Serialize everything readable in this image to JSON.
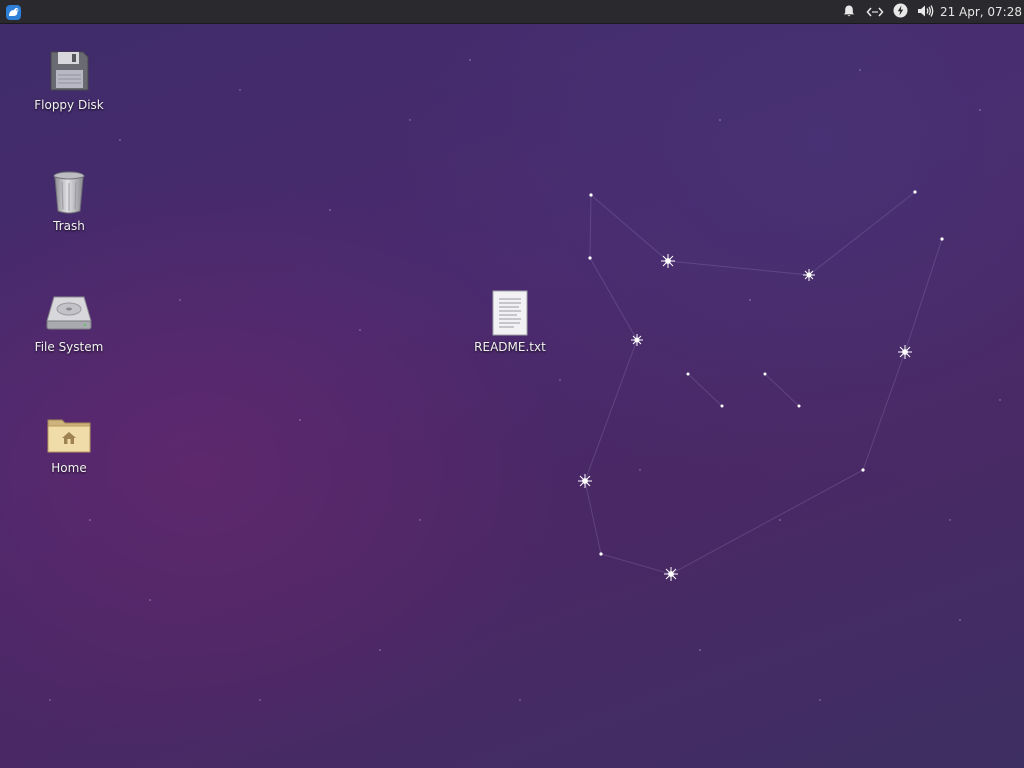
{
  "panel": {
    "menu_icon": "xfce-mouse-logo-icon",
    "tray": [
      {
        "name": "notifications",
        "icon": "bell-icon"
      },
      {
        "name": "network",
        "icon": "network-disconnected-icon"
      },
      {
        "name": "power",
        "icon": "power-bolt-icon"
      },
      {
        "name": "volume",
        "icon": "speaker-icon"
      }
    ],
    "clock": "21 Apr, 07:28"
  },
  "desktop_icons": [
    {
      "label": "Floppy Disk",
      "icon": "floppy-disk-icon"
    },
    {
      "label": "Trash",
      "icon": "trash-icon"
    },
    {
      "label": "File System",
      "icon": "hard-drive-icon"
    },
    {
      "label": "Home",
      "icon": "home-folder-icon"
    },
    {
      "label": "README.txt",
      "icon": "text-file-icon"
    }
  ],
  "colors": {
    "panel_bg": "#2a2a2e",
    "desktop_base": "#46296a",
    "menu_accent": "#2d7fd8"
  }
}
